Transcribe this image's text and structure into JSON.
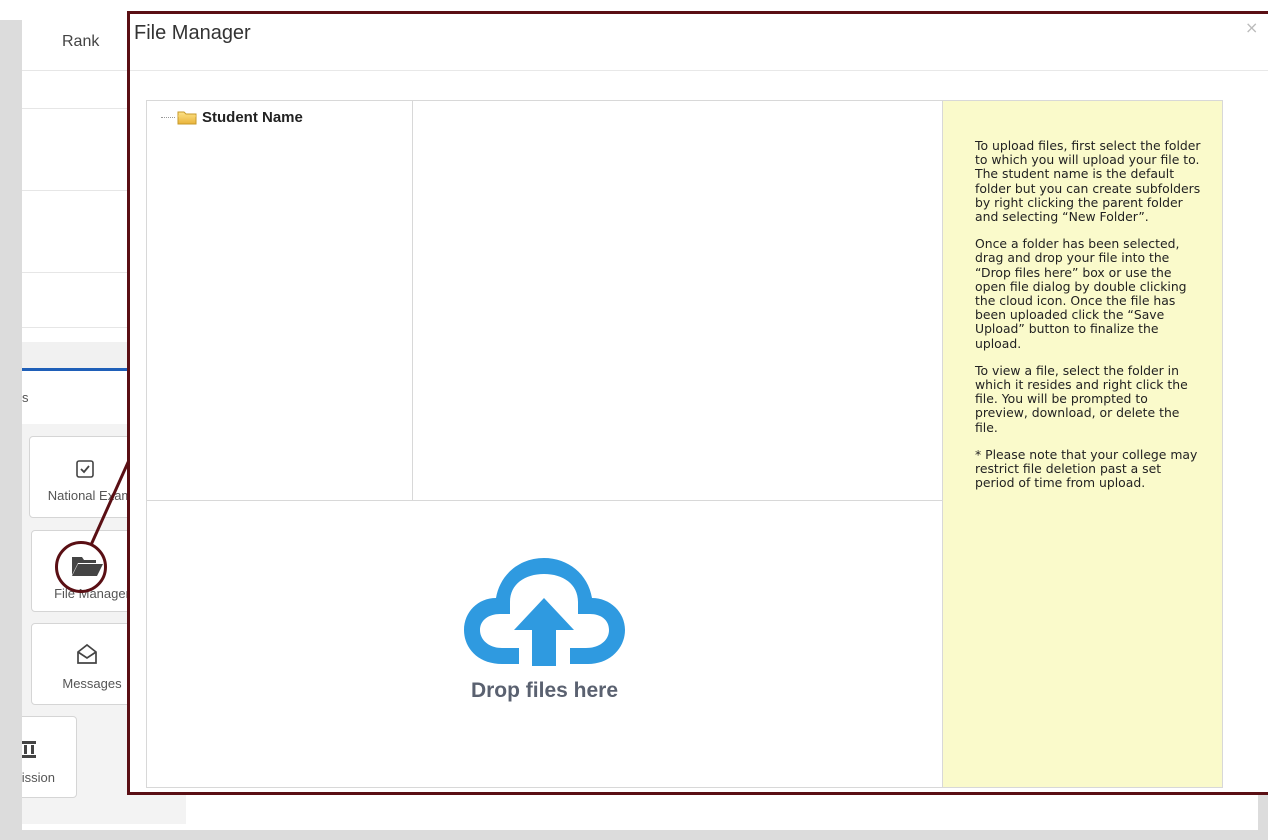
{
  "background": {
    "rank_label": "Rank",
    "partial_tab_text": "s",
    "tiles": [
      {
        "label": "National Exam",
        "icon": "checkbox-icon"
      },
      {
        "label": "File Manager",
        "icon": "folder-open-icon"
      },
      {
        "label": "Messages",
        "icon": "envelope-open-icon"
      },
      {
        "label": "Admission",
        "icon": "bank-icon"
      }
    ]
  },
  "modal": {
    "title": "File Manager",
    "close_label": "×"
  },
  "tree": {
    "root_label": "Student Name",
    "root_icon": "folder-icon"
  },
  "dropzone": {
    "icon": "cloud-upload-icon",
    "label": "Drop files here",
    "color": "#2f9ae0"
  },
  "help": {
    "paragraphs": [
      "To upload files, first select the folder to which you will upload your file to. The student name is the default folder but you can create subfolders by right clicking the parent folder and selecting “New Folder”.",
      "Once a folder has been selected, drag and drop your file into the “Drop files here” box or use the open file dialog by double clicking the cloud icon. Once the file has been uploaded click the “Save Upload” button to finalize the upload.",
      "To view a file, select the folder in which it resides and right click the file. You will be prompted to preview, download, or delete the file.",
      "* Please note that your college may restrict file deletion past a set period of time from upload."
    ]
  },
  "colors": {
    "callout": "#5a0f14",
    "help_background": "#fafacb",
    "accent_blue": "#1f5fb8"
  }
}
